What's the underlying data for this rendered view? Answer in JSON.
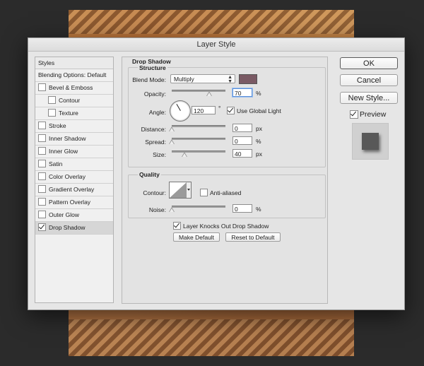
{
  "window": {
    "title": "Layer Style"
  },
  "styles_list": {
    "header": "Styles",
    "blending_options": "Blending Options: Default",
    "items": [
      {
        "label": "Bevel & Emboss",
        "checked": false,
        "sub": false
      },
      {
        "label": "Contour",
        "checked": false,
        "sub": true
      },
      {
        "label": "Texture",
        "checked": false,
        "sub": true
      },
      {
        "label": "Stroke",
        "checked": false,
        "sub": false
      },
      {
        "label": "Inner Shadow",
        "checked": false,
        "sub": false
      },
      {
        "label": "Inner Glow",
        "checked": false,
        "sub": false
      },
      {
        "label": "Satin",
        "checked": false,
        "sub": false
      },
      {
        "label": "Color Overlay",
        "checked": false,
        "sub": false
      },
      {
        "label": "Gradient Overlay",
        "checked": false,
        "sub": false
      },
      {
        "label": "Pattern Overlay",
        "checked": false,
        "sub": false
      },
      {
        "label": "Outer Glow",
        "checked": false,
        "sub": false
      },
      {
        "label": "Drop Shadow",
        "checked": true,
        "sub": false
      }
    ]
  },
  "drop_shadow": {
    "title": "Drop Shadow",
    "structure": {
      "title": "Structure",
      "blend_mode_label": "Blend Mode:",
      "blend_mode_value": "Multiply",
      "blend_color": "#7a5a64",
      "opacity_label": "Opacity:",
      "opacity_value": "70",
      "opacity_unit": "%",
      "angle_label": "Angle:",
      "angle_value": "120",
      "angle_unit": "°",
      "use_global_light_label": "Use Global Light",
      "use_global_light": true,
      "distance_label": "Distance:",
      "distance_value": "0",
      "distance_unit": "px",
      "spread_label": "Spread:",
      "spread_value": "0",
      "spread_unit": "%",
      "size_label": "Size:",
      "size_value": "40",
      "size_unit": "px"
    },
    "quality": {
      "title": "Quality",
      "contour_label": "Contour:",
      "anti_aliased_label": "Anti-aliased",
      "anti_aliased": false,
      "noise_label": "Noise:",
      "noise_value": "0",
      "noise_unit": "%"
    },
    "knocks_out_label": "Layer Knocks Out Drop Shadow",
    "knocks_out": true,
    "make_default_label": "Make Default",
    "reset_default_label": "Reset to Default"
  },
  "actions": {
    "ok_label": "OK",
    "cancel_label": "Cancel",
    "new_style_label": "New Style...",
    "preview_label": "Preview",
    "preview_checked": true
  },
  "colors": {
    "shadow_color": "#7a5a64",
    "preview_swatch": "#585858"
  }
}
